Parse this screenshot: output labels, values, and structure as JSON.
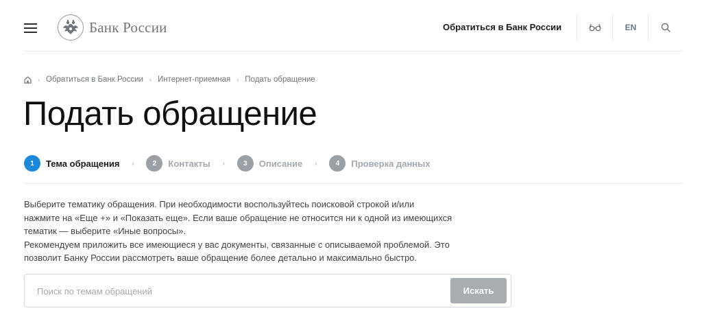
{
  "header": {
    "menu_icon": "hamburger-menu-icon",
    "logo_icon": "double-headed-eagle-emblem",
    "logo_text": "Банк России",
    "contact_link": "Обратиться в Банк России",
    "accessibility_icon": "glasses-icon",
    "lang_label": "EN",
    "search_icon": "search-icon"
  },
  "breadcrumb": {
    "home_icon": "home-icon",
    "items": [
      "Обратиться в Банк России",
      "Интернет-приемная",
      "Подать обращение"
    ]
  },
  "page_title": "Подать обращение",
  "steps": [
    {
      "number": "1",
      "label": "Тема обращения",
      "active": true
    },
    {
      "number": "2",
      "label": "Контакты",
      "active": false
    },
    {
      "number": "3",
      "label": "Описание",
      "active": false
    },
    {
      "number": "4",
      "label": "Проверка данных",
      "active": false
    }
  ],
  "description": {
    "line1": "Выберите тематику обращения. При необходимости воспользуйтесь поисковой строкой и/или",
    "line2": "нажмите на «Еще +» и «Показать еще». Если ваше обращение не относится ни к одной из имеющихся",
    "line3": "тематик — выберите «Иные вопросы».",
    "line4": "Рекомендуем приложить все имеющиеся у вас документы, связанные с описываемой проблемой. Это",
    "line5": "позволит Банку России рассмотреть ваше обращение более детально и максимально быстро."
  },
  "search": {
    "placeholder": "Поиск по темам обращений",
    "value": "",
    "button_label": "Искать"
  },
  "colors": {
    "accent": "#1e88d8",
    "inactive_step": "#9aa0a6",
    "disabled_button": "#a8adb2"
  }
}
